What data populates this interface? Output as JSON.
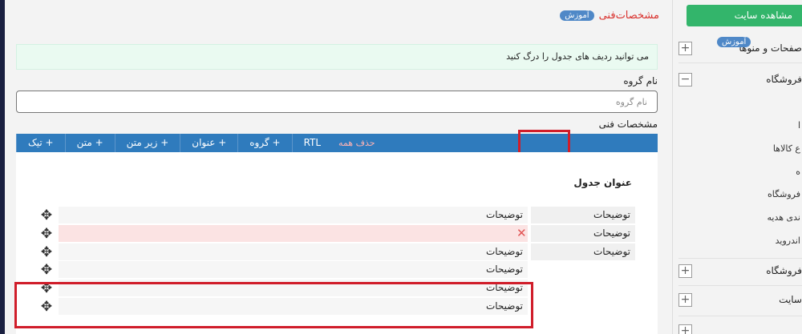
{
  "page_title": "مشخصات‌فنی",
  "title_badge": "آموزش",
  "notice": "می توانید ردیف های جدول را درگ کنید",
  "group": {
    "label": "نام گروه",
    "placeholder": "نام گروه"
  },
  "specs_label": "مشخصات فنی",
  "toolbar": {
    "buttons": [
      "+ تیک",
      "+ متن",
      "+ زیر متن",
      "+ عنوان",
      "+ گروه",
      "RTL"
    ],
    "delete_all": "حذف همه"
  },
  "table_title": "عنوان جدول",
  "rows": [
    {
      "key": "توضیحات",
      "value": "توضیحات"
    },
    {
      "key": "توضیحات",
      "value": "",
      "error": true
    },
    {
      "key": "توضیحات",
      "value": "توضیحات"
    },
    {
      "key": "",
      "value": "توضیحات"
    },
    {
      "key": "",
      "value": "توضیحات"
    },
    {
      "key": "",
      "value": "توضیحات"
    }
  ],
  "sidebar": {
    "view_site": "مشاهده سایت",
    "pages_menus": "صفحات و منوها",
    "pages_badge": "آموزش",
    "shop": "فروشگاه",
    "shop_items": [
      "ا",
      "ع کالاها",
      "ه",
      "فروشگاه",
      "ندی هدیه",
      "اندروید"
    ],
    "shop2": "فروشگاه",
    "site": "سایت",
    "colors": {
      "accent": "#2f7bbd",
      "green": "#33b56b",
      "red": "#d9322e"
    }
  }
}
